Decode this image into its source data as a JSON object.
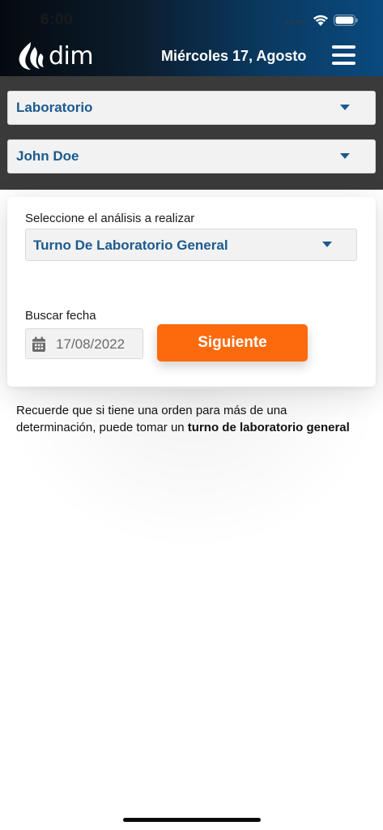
{
  "status_bar": {
    "time": "6:00"
  },
  "header": {
    "logo_text": "dim",
    "date": "Miércoles 17, Agosto",
    "menu_icon": "hamburger-menu-icon"
  },
  "filters": {
    "service_select": {
      "value": "Laboratorio"
    },
    "patient_select": {
      "value": "John Doe"
    }
  },
  "card": {
    "analysis_label": "Seleccione el análisis a realizar",
    "analysis_select": {
      "value": "Turno De Laboratorio General"
    },
    "date_label": "Buscar fecha",
    "date_field": {
      "value": "17/08/2022",
      "icon": "calendar-icon"
    },
    "next_button_label": "Siguiente"
  },
  "info": {
    "text_pre": "Recuerde que si tiene una orden para más de una determinación, puede tomar un ",
    "text_bold": "turno de laboratorio general"
  },
  "colors": {
    "accent": "#fd6a0e",
    "link_blue": "#1b5a8e",
    "header_dark": "#0b1c2c"
  }
}
